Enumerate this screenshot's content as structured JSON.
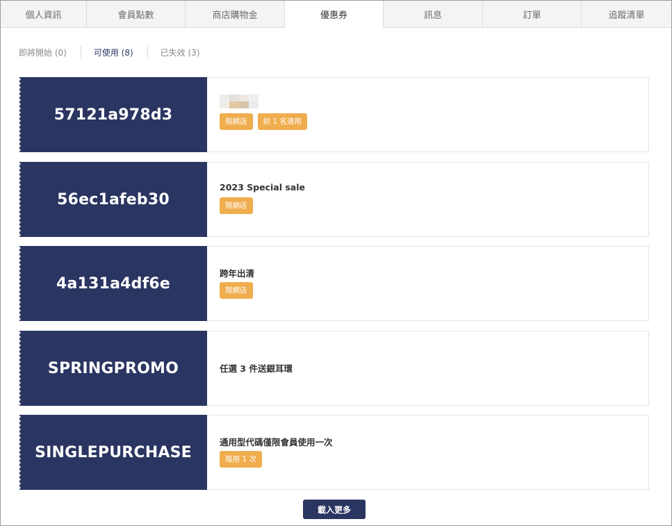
{
  "tabs": [
    {
      "label": "個人資訊"
    },
    {
      "label": "會員點數"
    },
    {
      "label": "商店購物金"
    },
    {
      "label": "優惠券"
    },
    {
      "label": "訊息"
    },
    {
      "label": "訂單"
    },
    {
      "label": "追蹤清單"
    }
  ],
  "filters": [
    {
      "label": "即將開始 (0)"
    },
    {
      "label": "可使用 (8)"
    },
    {
      "label": "已失效 (3)"
    }
  ],
  "coupons": [
    {
      "code": "57121a978d3",
      "title": "",
      "tags": [
        "限網店",
        "前 1 名適用"
      ]
    },
    {
      "code": "56ec1afeb30",
      "title": "2023 Special sale",
      "tags": [
        "限網店"
      ]
    },
    {
      "code": "4a131a4df6e",
      "title": "跨年出清",
      "tags": [
        "限網店"
      ]
    },
    {
      "code": "SPRINGPROMO",
      "title": "任選 3 件送銀耳環",
      "tags": []
    },
    {
      "code": "SINGLEPURCHASE",
      "title": "通用型代碼僅限會員使用一次",
      "tags": [
        "限用 1 次"
      ]
    }
  ],
  "load_more_label": "載入更多",
  "colors": {
    "navy": "#2a3561",
    "tag_orange": "#f0ad4e",
    "tab_bg": "#f4f4f4"
  }
}
